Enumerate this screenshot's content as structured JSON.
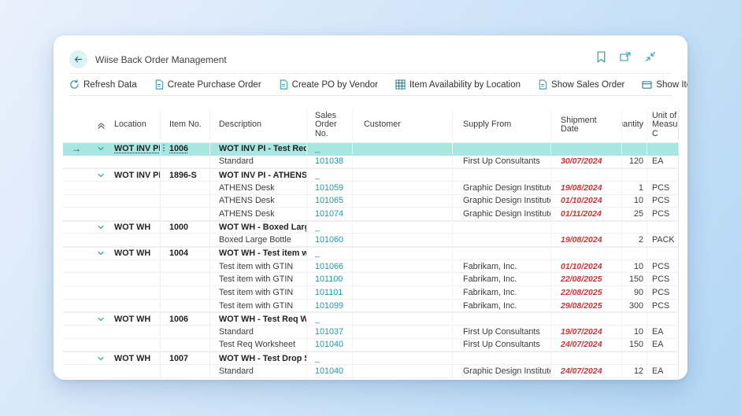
{
  "colors": {
    "accent": "#2a9ba3",
    "selected_row": "#a7e6e1",
    "link": "#1f9aa8",
    "late_date": "#d13438"
  },
  "window": {
    "title": "Wiise Back Order Management"
  },
  "toolbar": {
    "actions": [
      {
        "label": "Refresh Data",
        "icon": "refresh-icon"
      },
      {
        "label": "Create Purchase Order",
        "icon": "document-icon"
      },
      {
        "label": "Create PO by Vendor",
        "icon": "document-icon"
      },
      {
        "label": "Item Availability by Location",
        "icon": "grid-icon"
      },
      {
        "label": "Show Sales Order",
        "icon": "document-icon"
      },
      {
        "label": "Show Item Card",
        "icon": "card-icon"
      }
    ],
    "ellipsis_label": "⋯"
  },
  "table": {
    "columns": {
      "location": "Location",
      "item_no": "Item No.",
      "description": "Description",
      "sales_order_no": "Sales Order\nNo.",
      "customer": "Customer",
      "supply_from": "Supply From",
      "shipment_date": "Shipment\nDate",
      "quantity": "Quantity",
      "unit_of_measure": "Unit of\nMeasure C"
    },
    "rows": [
      {
        "type": "group",
        "selected": true,
        "location": "WOT INV PI",
        "item_no": "1006",
        "description": "WOT INV PI - Test Req Work...",
        "sales_order_no": "_",
        "customer": "",
        "supply_from": "",
        "shipment_date": "",
        "quantity": "",
        "uom": ""
      },
      {
        "type": "detail",
        "description": "Standard",
        "sales_order_no": "101038",
        "customer": "",
        "supply_from": "First Up Consultants",
        "shipment_date": "30/07/2024",
        "quantity": "120",
        "uom": "EA"
      },
      {
        "type": "group",
        "location": "WOT INV PI",
        "item_no": "1896-S",
        "description": "WOT INV PI - ATHENS Desk ...",
        "sales_order_no": "_",
        "customer": "",
        "supply_from": "",
        "shipment_date": "",
        "quantity": "",
        "uom": ""
      },
      {
        "type": "detail",
        "description": "ATHENS Desk",
        "sales_order_no": "101059",
        "customer": "",
        "supply_from": "Graphic Design Institute",
        "shipment_date": "19/08/2024",
        "quantity": "1",
        "uom": "PCS"
      },
      {
        "type": "detail",
        "description": "ATHENS Desk",
        "sales_order_no": "101065",
        "customer": "",
        "supply_from": "Graphic Design Institute",
        "shipment_date": "01/10/2024",
        "quantity": "10",
        "uom": "PCS"
      },
      {
        "type": "detail",
        "description": "ATHENS Desk",
        "sales_order_no": "101074",
        "customer": "",
        "supply_from": "Graphic Design Institute",
        "shipment_date": "01/11/2024",
        "quantity": "25",
        "uom": "PCS"
      },
      {
        "type": "group",
        "location": "WOT WH",
        "item_no": "1000",
        "description": "WOT WH - Boxed Large Bott...",
        "sales_order_no": "_",
        "customer": "",
        "supply_from": "",
        "shipment_date": "",
        "quantity": "",
        "uom": ""
      },
      {
        "type": "detail",
        "description": "Boxed Large Bottle",
        "sales_order_no": "101060",
        "customer": "",
        "supply_from": "",
        "shipment_date": "19/08/2024",
        "quantity": "2",
        "uom": "PACK"
      },
      {
        "type": "group",
        "location": "WOT WH",
        "item_no": "1004",
        "description": "WOT WH - Test item with GT...",
        "sales_order_no": "_",
        "customer": "",
        "supply_from": "",
        "shipment_date": "",
        "quantity": "",
        "uom": ""
      },
      {
        "type": "detail",
        "description": "Test item with GTIN",
        "sales_order_no": "101066",
        "customer": "",
        "supply_from": "Fabrikam, Inc.",
        "shipment_date": "01/10/2024",
        "quantity": "10",
        "uom": "PCS"
      },
      {
        "type": "detail",
        "description": "Test item with GTIN",
        "sales_order_no": "101100",
        "customer": "",
        "supply_from": "Fabrikam, Inc.",
        "shipment_date": "22/08/2025",
        "quantity": "150",
        "uom": "PCS"
      },
      {
        "type": "detail",
        "description": "Test item with GTIN",
        "sales_order_no": "101101",
        "customer": "",
        "supply_from": "Fabrikam, Inc.",
        "shipment_date": "22/08/2025",
        "quantity": "90",
        "uom": "PCS"
      },
      {
        "type": "detail",
        "description": "Test item with GTIN",
        "sales_order_no": "101099",
        "customer": "",
        "supply_from": "Fabrikam, Inc.",
        "shipment_date": "29/08/2025",
        "quantity": "300",
        "uom": "PCS"
      },
      {
        "type": "group",
        "location": "WOT WH",
        "item_no": "1006",
        "description": "WOT WH - Test Req Worksh...",
        "sales_order_no": "_",
        "customer": "",
        "supply_from": "",
        "shipment_date": "",
        "quantity": "",
        "uom": ""
      },
      {
        "type": "detail",
        "description": "Standard",
        "sales_order_no": "101037",
        "customer": "",
        "supply_from": "First Up Consultants",
        "shipment_date": "19/07/2024",
        "quantity": "10",
        "uom": "EA"
      },
      {
        "type": "detail",
        "description": "Test Req Worksheet",
        "sales_order_no": "101040",
        "customer": "",
        "supply_from": "First Up Consultants",
        "shipment_date": "24/07/2024",
        "quantity": "150",
        "uom": "EA"
      },
      {
        "type": "group",
        "location": "WOT WH",
        "item_no": "1007",
        "description": "WOT WH - Test Drop Shipm...",
        "sales_order_no": "_",
        "customer": "",
        "supply_from": "",
        "shipment_date": "",
        "quantity": "",
        "uom": ""
      },
      {
        "type": "detail",
        "description": "Standard",
        "sales_order_no": "101040",
        "customer": "",
        "supply_from": "Graphic Design Institute",
        "shipment_date": "24/07/2024",
        "quantity": "12",
        "uom": "EA"
      }
    ]
  }
}
